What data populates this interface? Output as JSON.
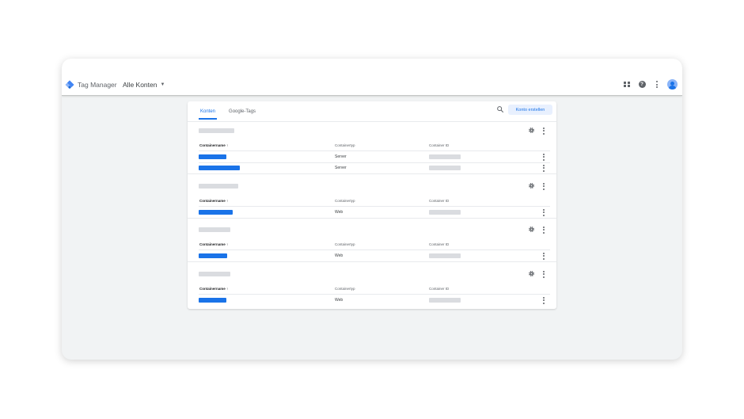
{
  "app": {
    "name": "Tag Manager",
    "account_switcher": "Alle Konten",
    "icons": [
      "apps-grid-icon",
      "help-icon",
      "more-vert-icon",
      "avatar"
    ]
  },
  "tabs": [
    {
      "label": "Konten",
      "active": true
    },
    {
      "label": "Google-Tags",
      "active": false
    }
  ],
  "actions": {
    "create_account": "Konto erstellen",
    "search_icon": "search-icon"
  },
  "table_headers": {
    "name": "Containername",
    "sort_indicator": "↑",
    "type": "Containertyp",
    "id": "Container ID"
  },
  "accounts": [
    {
      "containers": [
        {
          "type": "Server"
        },
        {
          "type": "Server"
        }
      ]
    },
    {
      "containers": [
        {
          "type": "Web"
        }
      ]
    },
    {
      "containers": [
        {
          "type": "Web"
        }
      ]
    },
    {
      "containers": [
        {
          "type": "Web"
        }
      ]
    }
  ],
  "colors": {
    "accent": "#1a73e8",
    "redacted": "#dadce0",
    "background": "#f1f3f4"
  }
}
